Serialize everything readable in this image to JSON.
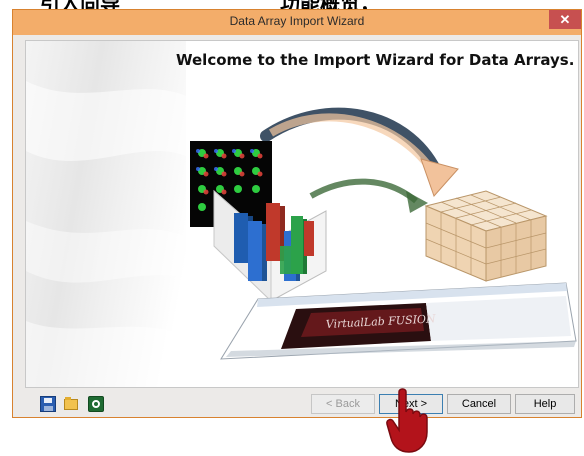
{
  "top_text": "引入向导　　　　　　　　功能概览，",
  "window": {
    "title": "Data Array Import Wizard",
    "close_glyph": "✕"
  },
  "page": {
    "heading": "Welcome to the Import Wizard for Data Arrays."
  },
  "screenshot_brand": "VirtualLab FUSION",
  "toolbar_icons": [
    "save-icon",
    "open-folder-icon",
    "reset-icon"
  ],
  "buttons": {
    "back": "< Back",
    "next": "Next >",
    "cancel": "Cancel",
    "help": "Help"
  },
  "colors": {
    "titlebar": "#f3ad6a",
    "close": "#c75050",
    "window_border": "#d8822f"
  }
}
